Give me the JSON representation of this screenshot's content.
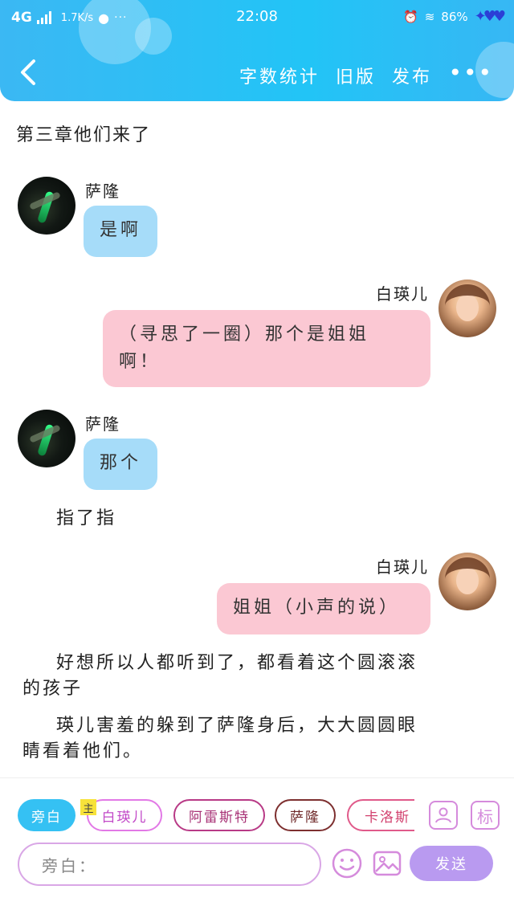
{
  "status_bar": {
    "network": "4G",
    "speed": "1.7K/s",
    "time": "22:08",
    "battery": "86%"
  },
  "navbar": {
    "word_count": "字数统计",
    "old_version": "旧版",
    "publish": "发布"
  },
  "chapter_title": "第三章他们来了",
  "messages": [
    {
      "speaker": "萨隆",
      "text": "是啊"
    },
    {
      "speaker": "白瑛儿",
      "text_line1": "（寻思了一圈）那个是姐姐",
      "text_line2": "啊！"
    },
    {
      "speaker": "萨隆",
      "text": "那个"
    },
    {
      "speaker": "白瑛儿",
      "text": "姐姐（小声的说）"
    }
  ],
  "narrations": [
    {
      "text": "指了指"
    },
    {
      "text_line1": "好想所以人都听到了，都看着这个圆滚滚",
      "text_line2": "的孩子"
    },
    {
      "text_line1": "瑛儿害羞的躲到了萨隆身后，大大圆圆眼",
      "text_line2": "睛看着他们。"
    }
  ],
  "bottom": {
    "roles": [
      "旁白",
      "白瑛儿",
      "阿雷斯特",
      "萨隆",
      "卡洛斯"
    ],
    "main_badge": "主",
    "tag_icon_label": "标",
    "input_placeholder": "旁白：",
    "send": "发送"
  },
  "colors": {
    "header": "#22c4f6",
    "bubble_left": "#a6dcf9",
    "bubble_right": "#fbc8d3",
    "send_button": "#b99af0"
  }
}
